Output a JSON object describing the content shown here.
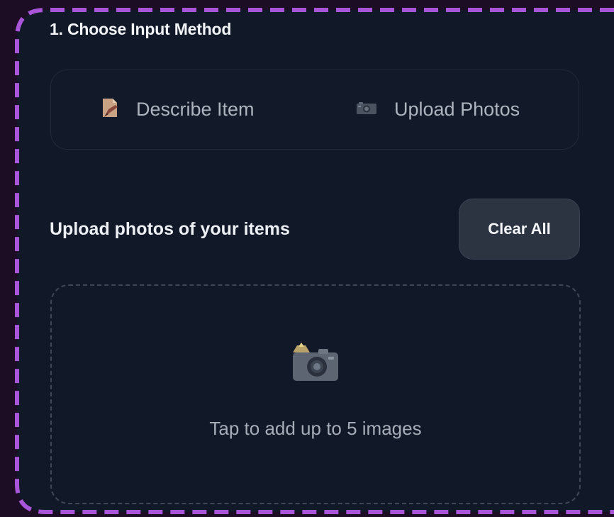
{
  "section": {
    "title": "1. Choose Input Method"
  },
  "input_method": {
    "options": [
      {
        "label": "Describe Item",
        "icon": "memo-icon"
      },
      {
        "label": "Upload Photos",
        "icon": "camera-icon"
      }
    ]
  },
  "upload": {
    "heading": "Upload photos of your items",
    "clear_label": "Clear All",
    "dropzone_icon": "camera-with-flash-icon",
    "dropzone_text": "Tap to add up to 5 images"
  },
  "colors": {
    "outline_accent": "#a855d9",
    "panel_background": "#111827",
    "page_background": "#1c0d24"
  }
}
